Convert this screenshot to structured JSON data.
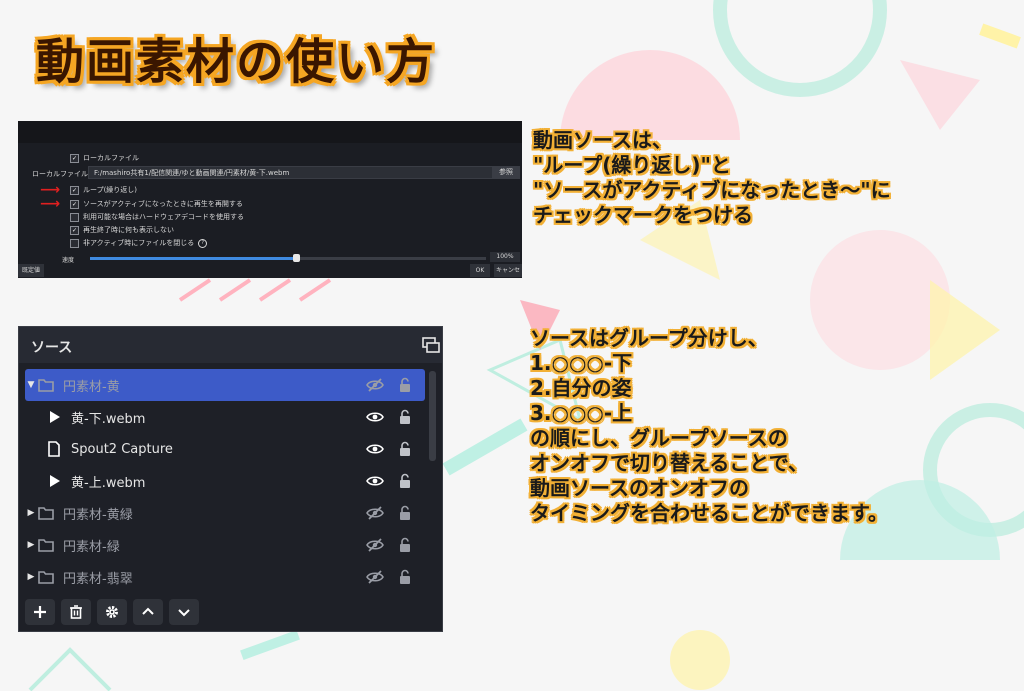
{
  "title": "動画素材の使い方",
  "properties_panel": {
    "local_file_checkbox": "ローカルファイル",
    "local_file_label": "ローカルファイル",
    "local_file_path": "F:/mashiro共有1/配信関連/ゆと動画関連/円素材/黄-下.webm",
    "browse_button": "参照",
    "options": [
      {
        "label": "ループ(繰り返し)",
        "checked": true,
        "arrow": true
      },
      {
        "label": "ソースがアクティブになったときに再生を再開する",
        "checked": true,
        "arrow": true
      },
      {
        "label": "利用可能な場合はハードウェアデコードを使用する",
        "checked": false,
        "arrow": false
      },
      {
        "label": "再生終了時に何も表示しない",
        "checked": true,
        "arrow": false
      },
      {
        "label": "非アクティブ時にファイルを閉じる",
        "checked": false,
        "arrow": false
      }
    ],
    "help_glyph": "?",
    "speed_label": "速度",
    "speed_value": "100%",
    "speed_fill": 0.52,
    "defaults_button": "既定値",
    "ok_button": "OK",
    "cancel_button": "キャンセル"
  },
  "sources_panel": {
    "title": "ソース",
    "items": [
      {
        "name": "円素材-黄",
        "type": "group",
        "expanded": true,
        "selected": true,
        "visible": false,
        "dim": true
      },
      {
        "name": "黄-下.webm",
        "type": "media",
        "selected": false,
        "visible": true,
        "dim": false
      },
      {
        "name": "Spout2 Capture",
        "type": "file",
        "selected": false,
        "visible": true,
        "dim": false
      },
      {
        "name": "黄-上.webm",
        "type": "media",
        "selected": false,
        "visible": true,
        "dim": false
      },
      {
        "name": "円素材-黄緑",
        "type": "group",
        "expanded": false,
        "selected": false,
        "visible": false,
        "dim": true
      },
      {
        "name": "円素材-緑",
        "type": "group",
        "expanded": false,
        "selected": false,
        "visible": false,
        "dim": true
      },
      {
        "name": "円素材-翡翠",
        "type": "group",
        "expanded": false,
        "selected": false,
        "visible": false,
        "dim": true
      }
    ],
    "toolbar": [
      "plus-icon",
      "trash-icon",
      "gear-icon",
      "chevron-up-icon",
      "chevron-down-icon"
    ]
  },
  "note1": "動画ソースは、\n\"ループ(繰り返し)\"と\n\"ソースがアクティブになったとき～\"に\nチェックマークをつける",
  "note2": "ソースはグループ分けし、\n1.○○○-下\n2.自分の姿\n3.○○○-上\nの順にし、グループソースの\nオンオフで切り替えることで、\n動画ソースのオンオフの\nタイミングを合わせることができます。",
  "colors": {
    "accent": "#3d5bc8",
    "title_outline": "#f5a623",
    "note_outline": "#f2b035",
    "arrow": "#e02020"
  }
}
